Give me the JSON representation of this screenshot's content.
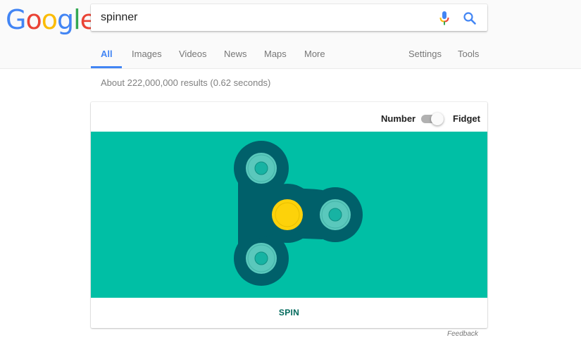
{
  "logo": {
    "letters": [
      "G",
      "o",
      "o",
      "g",
      "l",
      "e"
    ],
    "colors": [
      "#4285f4",
      "#ea4335",
      "#fbbc05",
      "#4285f4",
      "#34a853",
      "#ea4335"
    ]
  },
  "search": {
    "query": "spinner",
    "mic_icon": "microphone-icon",
    "search_icon": "magnifier-icon"
  },
  "tabs": [
    {
      "label": "All",
      "active": true
    },
    {
      "label": "Images"
    },
    {
      "label": "Videos"
    },
    {
      "label": "News"
    },
    {
      "label": "Maps"
    },
    {
      "label": "More"
    }
  ],
  "tools": {
    "settings": "Settings",
    "tools": "Tools"
  },
  "results_stats": "About 222,000,000 results (0.62 seconds)",
  "widget": {
    "toggle_left": "Number",
    "toggle_right": "Fidget",
    "toggle_state": "Fidget",
    "spin_label": "SPIN",
    "colors": {
      "background": "#00bfa5",
      "body": "#00606a",
      "bearing_outer": "#5ac8bc",
      "bearing_inner": "#17b3a3",
      "center": "#fdd20a"
    }
  },
  "feedback": "Feedback"
}
